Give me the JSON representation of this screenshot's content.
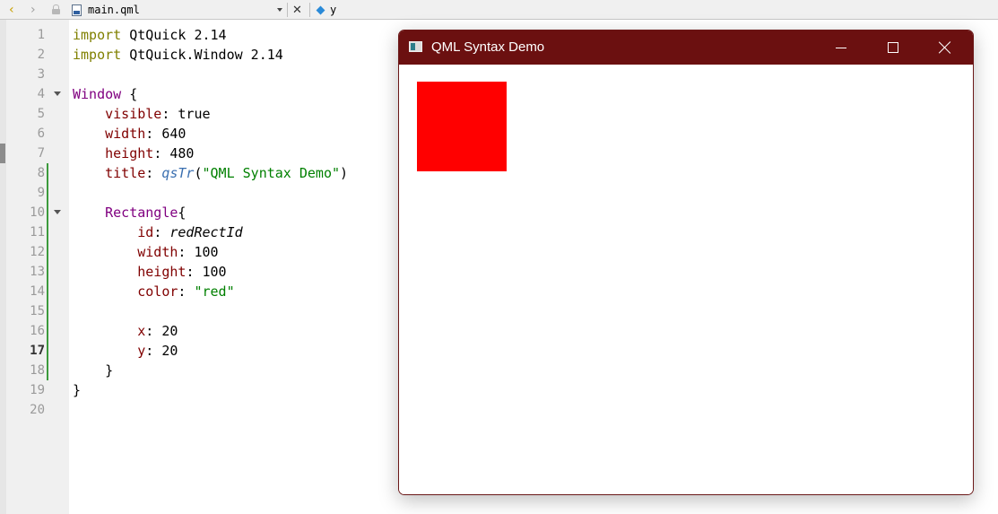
{
  "toolbar": {
    "back_icon": "chevron-left-icon",
    "forward_icon": "chevron-right-icon",
    "file_name": "main.qml",
    "dropdown_icon": "dropdown-arrow-icon",
    "close_icon": "close-icon",
    "symbol": "y",
    "symbol_icon": "diamond-icon"
  },
  "editor": {
    "lines": [
      {
        "number": "1",
        "text": "import QtQuick 2.14"
      },
      {
        "number": "2",
        "text": "import QtQuick.Window 2.14"
      },
      {
        "number": "3",
        "text": ""
      },
      {
        "number": "4",
        "text": "Window {"
      },
      {
        "number": "5",
        "text": "    visible: true"
      },
      {
        "number": "6",
        "text": "    width: 640"
      },
      {
        "number": "7",
        "text": "    height: 480"
      },
      {
        "number": "8",
        "text": "    title: qsTr(\"QML Syntax Demo\")"
      },
      {
        "number": "9",
        "text": ""
      },
      {
        "number": "10",
        "text": "    Rectangle{"
      },
      {
        "number": "11",
        "text": "        id: redRectId"
      },
      {
        "number": "12",
        "text": "        width: 100"
      },
      {
        "number": "13",
        "text": "        height: 100"
      },
      {
        "number": "14",
        "text": "        color: \"red\""
      },
      {
        "number": "15",
        "text": ""
      },
      {
        "number": "16",
        "text": "        x: 20"
      },
      {
        "number": "17",
        "text": "        y: 20"
      },
      {
        "number": "18",
        "text": "    }"
      },
      {
        "number": "19",
        "text": "}"
      },
      {
        "number": "20",
        "text": ""
      }
    ],
    "current_line": "17"
  },
  "qml_window": {
    "title": "QML Syntax Demo",
    "minimize_icon": "minimize-icon",
    "maximize_icon": "maximize-icon",
    "close_icon": "close-icon",
    "rect_color": "#ff0000",
    "titlebar_color": "#6b1010"
  }
}
